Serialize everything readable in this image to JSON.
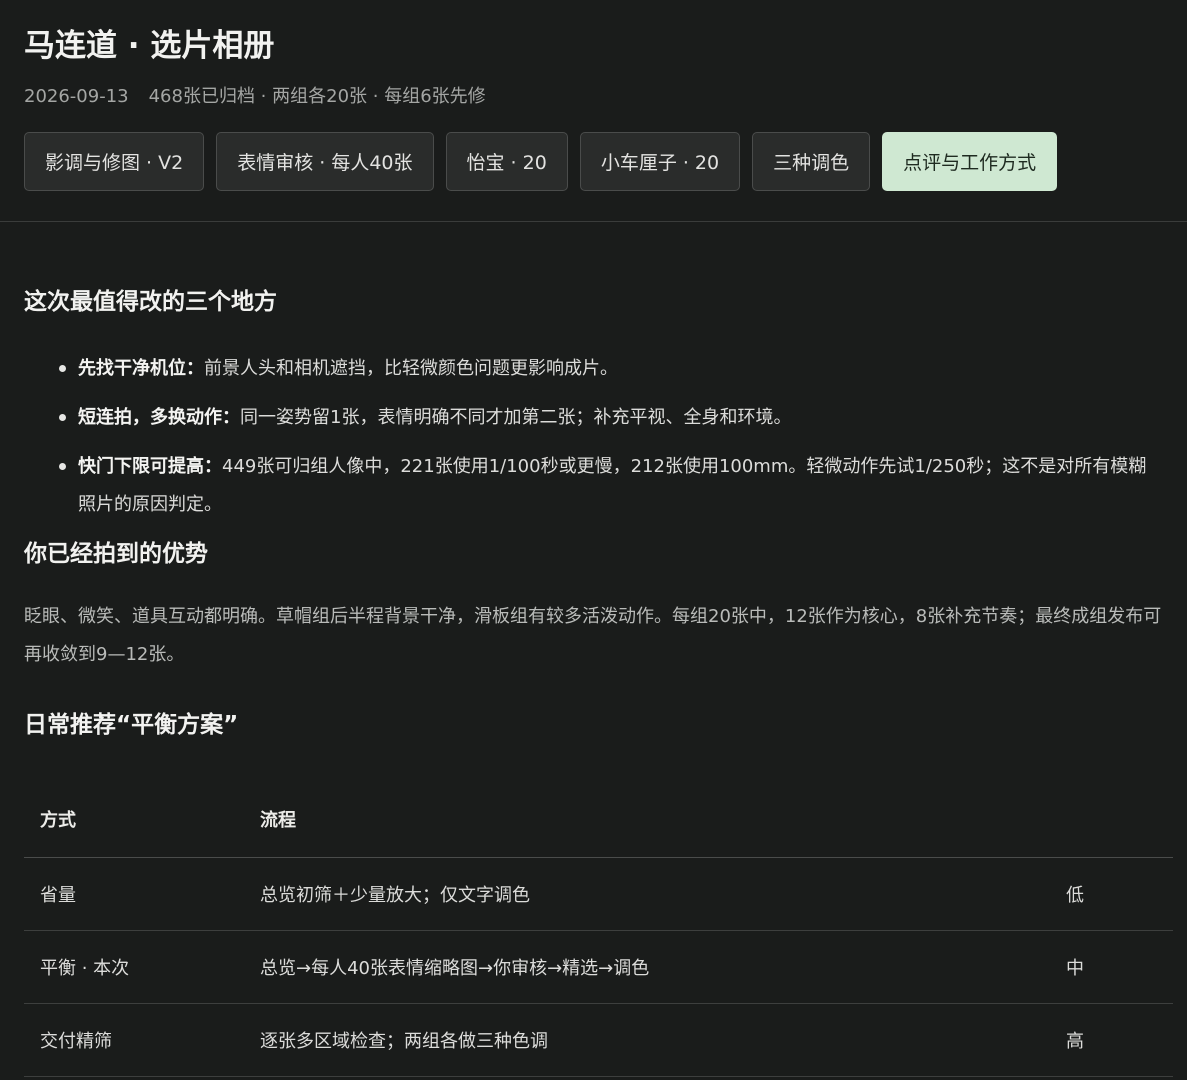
{
  "header": {
    "title": "马连道 · 选片相册",
    "date": "2026-09-13",
    "summary": "468张已归档 · 两组各20张 · 每组6张先修"
  },
  "tabs": [
    {
      "label": "影调与修图 · V2",
      "active": false
    },
    {
      "label": "表情审核 · 每人40张",
      "active": false
    },
    {
      "label": "怡宝 · 20",
      "active": false
    },
    {
      "label": "小车厘子 · 20",
      "active": false
    },
    {
      "label": "三种调色",
      "active": false
    },
    {
      "label": "点评与工作方式",
      "active": true
    }
  ],
  "section1": {
    "heading": "这次最值得改的三个地方",
    "points": [
      {
        "bold": "先找干净机位：",
        "text": "前景人头和相机遮挡，比轻微颜色问题更影响成片。"
      },
      {
        "bold": "短连拍，多换动作：",
        "text": "同一姿势留1张，表情明确不同才加第二张；补充平视、全身和环境。"
      },
      {
        "bold": "快门下限可提高：",
        "text": "449张可归组人像中，221张使用1/100秒或更慢，212张使用100mm。轻微动作先试1/250秒；这不是对所有模糊照片的原因判定。"
      }
    ]
  },
  "section2": {
    "heading": "你已经拍到的优势",
    "paragraph": "眨眼、微笑、道具互动都明确。草帽组后半程背景干净，滑板组有较多活泼动作。每组20张中，12张作为核心，8张补充节奏；最终成组发布可再收敛到9—12张。"
  },
  "section3": {
    "heading": "日常推荐“平衡方案”",
    "columns": [
      "方式",
      "流程",
      ""
    ],
    "rows": [
      {
        "mode": "省量",
        "flow": "总览初筛＋少量放大；仅文字调色",
        "level": "低"
      },
      {
        "mode": "平衡 · 本次",
        "flow": "总览→每人40张表情缩略图→你审核→精选→调色",
        "level": "中"
      },
      {
        "mode": "交付精筛",
        "flow": "逐张多区域检查；两组各做三种色调",
        "level": "高"
      }
    ]
  }
}
